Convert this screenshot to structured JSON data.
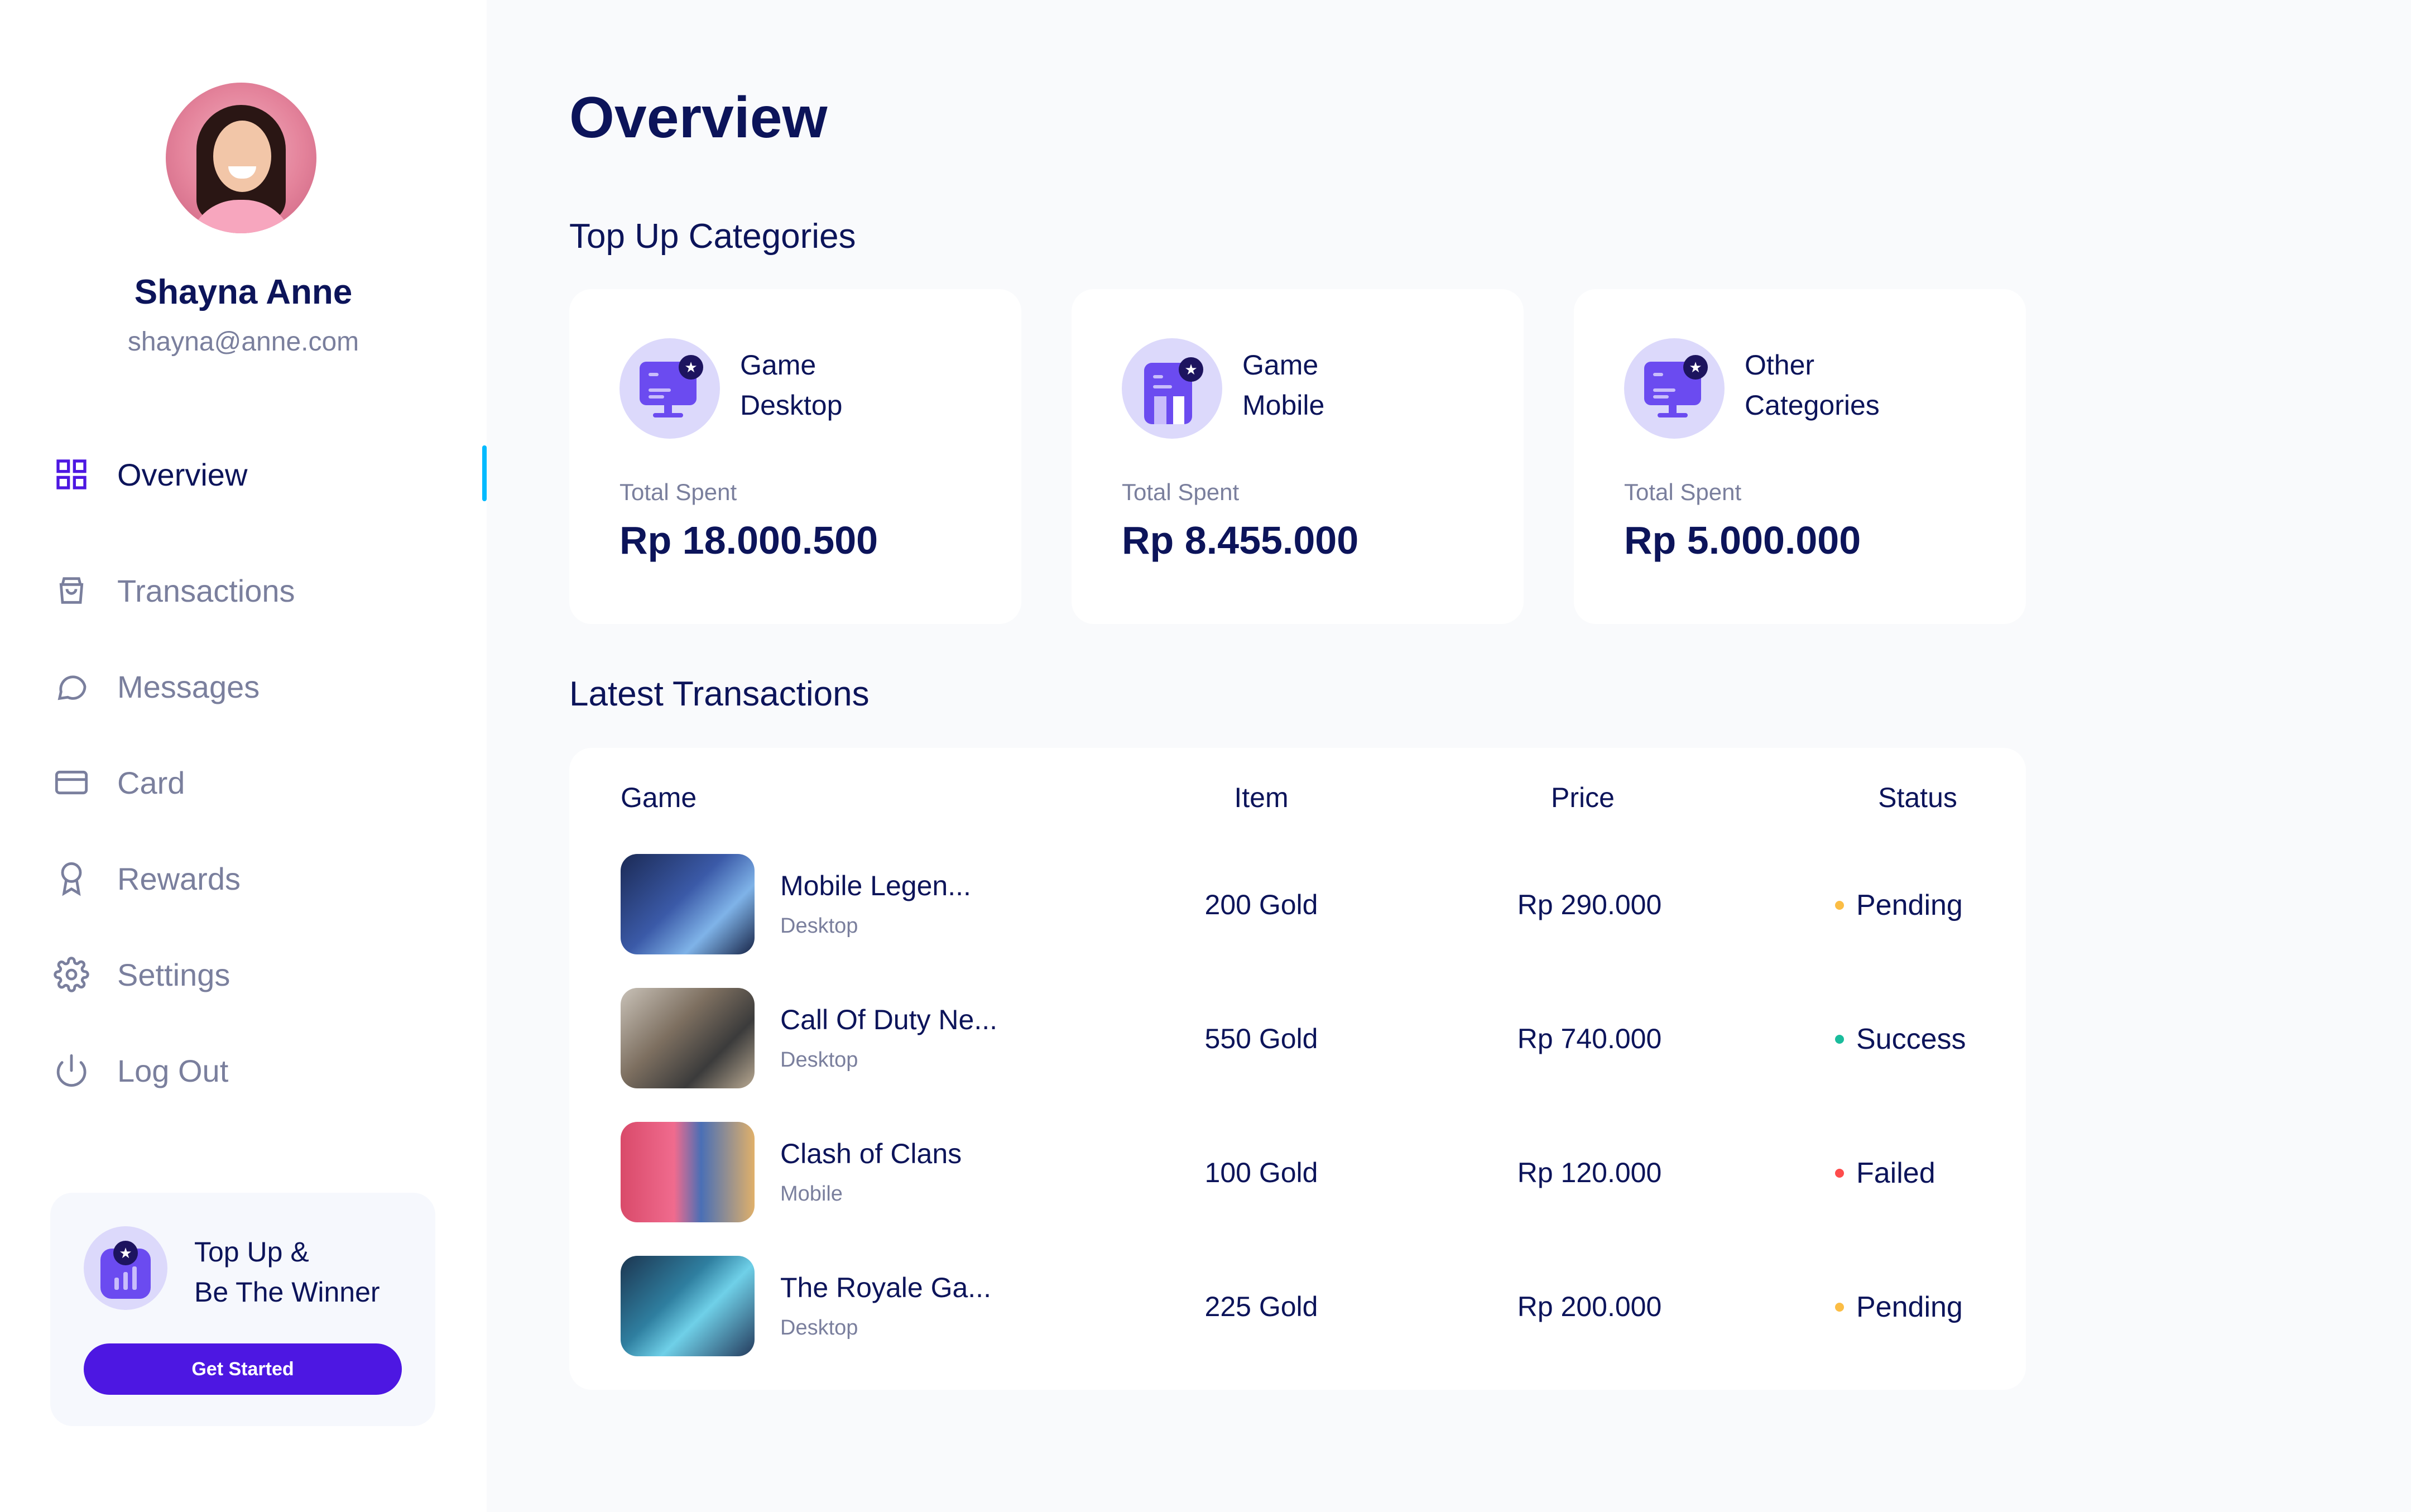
{
  "profile": {
    "name": "Shayna Anne",
    "email": "shayna@anne.com"
  },
  "nav": {
    "items": [
      {
        "label": "Overview",
        "icon": "grid-icon",
        "active": true
      },
      {
        "label": "Transactions",
        "icon": "shopping-bag-icon"
      },
      {
        "label": "Messages",
        "icon": "chat-bubble-icon"
      },
      {
        "label": "Card",
        "icon": "credit-card-icon"
      },
      {
        "label": "Rewards",
        "icon": "award-icon"
      },
      {
        "label": "Settings",
        "icon": "gear-icon"
      },
      {
        "label": "Log Out",
        "icon": "power-icon"
      }
    ]
  },
  "promo": {
    "line1": "Top Up &",
    "line2": "Be The Winner",
    "button": "Get Started"
  },
  "main": {
    "title": "Overview",
    "categories_title": "Top Up Categories",
    "transactions_title": "Latest Transactions"
  },
  "categories": [
    {
      "line1": "Game",
      "line2": "Desktop",
      "spent_label": "Total Spent",
      "amount": "Rp 18.000.500",
      "icon": "desktop-icon"
    },
    {
      "line1": "Game",
      "line2": "Mobile",
      "spent_label": "Total Spent",
      "amount": "Rp 8.455.000",
      "icon": "mobile-icon"
    },
    {
      "line1": "Other",
      "line2": "Categories",
      "spent_label": "Total Spent",
      "amount": "Rp 5.000.000",
      "icon": "desktop-icon"
    }
  ],
  "transactions": {
    "headers": {
      "game": "Game",
      "item": "Item",
      "price": "Price",
      "status": "Status"
    },
    "rows": [
      {
        "game": "Mobile Legen...",
        "platform": "Desktop",
        "item": "200 Gold",
        "price": "Rp 290.000",
        "status": "Pending",
        "status_color": "#fbbd45"
      },
      {
        "game": "Call Of Duty Ne...",
        "platform": "Desktop",
        "item": "550 Gold",
        "price": "Rp 740.000",
        "status": "Success",
        "status_color": "#1abc9c"
      },
      {
        "game": "Clash of Clans",
        "platform": "Mobile",
        "item": "100 Gold",
        "price": "Rp 120.000",
        "status": "Failed",
        "status_color": "#fe4c4c"
      },
      {
        "game": "The Royale Ga...",
        "platform": "Desktop",
        "item": "225 Gold",
        "price": "Rp 200.000",
        "status": "Pending",
        "status_color": "#fbbd45"
      }
    ]
  },
  "colors": {
    "accent": "#4d17e2",
    "active_indicator": "#00baff",
    "text_primary": "#0c145a",
    "text_secondary": "#7a7f9d",
    "icon_bg": "#dcd9fb",
    "icon_fg": "#6b4bf0"
  }
}
